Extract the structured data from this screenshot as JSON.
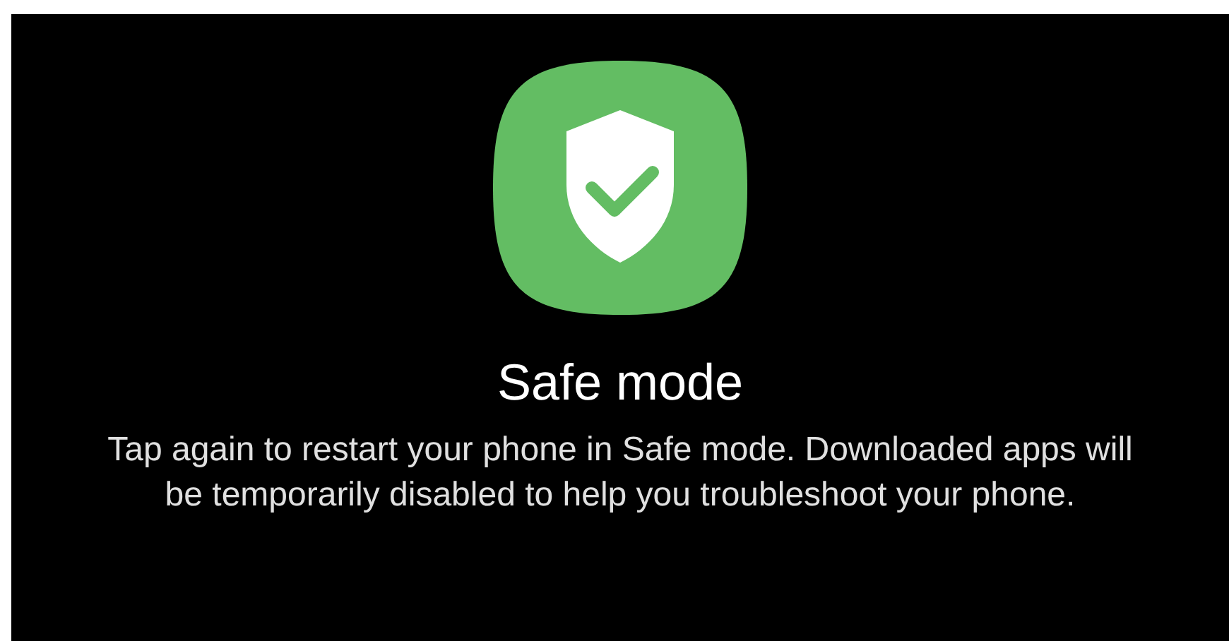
{
  "dialog": {
    "title": "Safe mode",
    "message": "Tap again to restart your phone in Safe mode. Downloaded apps will be temporarily disabled to help you troubleshoot your phone."
  }
}
